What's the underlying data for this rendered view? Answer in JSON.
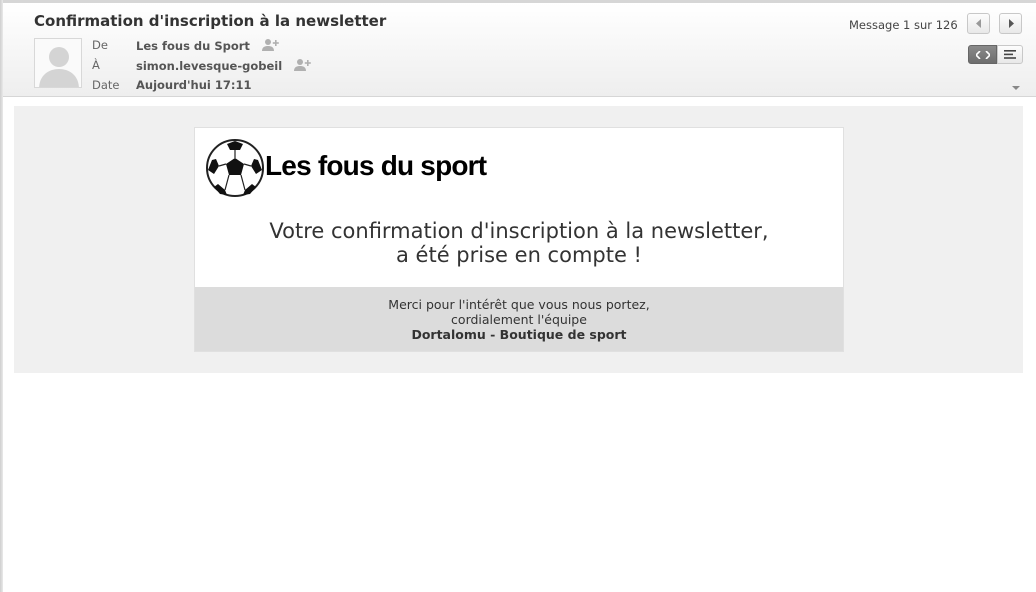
{
  "email": {
    "subject": "Confirmation d'inscription à la newsletter",
    "from_label": "De",
    "from_value": "Les fous du Sport",
    "to_label": "À",
    "to_value": "simon.levesque-gobeil",
    "date_label": "Date",
    "date_value": "Aujourd'hui 17:11",
    "counter": "Message 1 sur 126"
  },
  "newsletter": {
    "brand": "Les fous du sport",
    "headline_line1": "Votre confirmation d'inscription à la newsletter,",
    "headline_line2": "a été prise en compte !",
    "footer_line1": "Merci pour l'intérêt que vous nous portez,",
    "footer_line2": "cordialement l'équipe",
    "footer_line3": "Dortalomu - Boutique de sport"
  },
  "icons": {
    "avatar": "person-silhouette-icon",
    "add_contact": "add-contact-icon",
    "prev": "arrow-left-icon",
    "next": "arrow-right-icon",
    "html_view": "code-icon",
    "text_view": "lines-icon",
    "expand": "chevron-down-icon",
    "logo": "soccer-ball-icon"
  },
  "colors": {
    "header_bg": "#f5f5f5",
    "body_bg": "#f0f0f0",
    "footer_bg": "#dcdcdc",
    "active_toggle": "#707070"
  }
}
